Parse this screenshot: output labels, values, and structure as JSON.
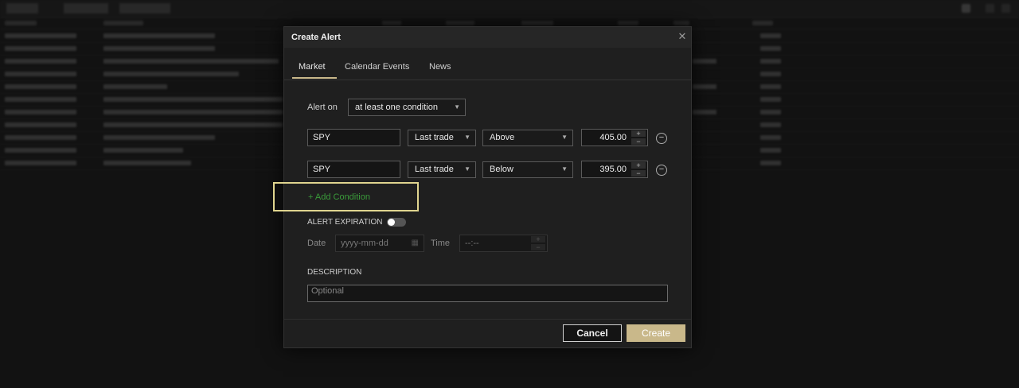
{
  "modal": {
    "title": "Create Alert",
    "close_icon": "close-icon",
    "tabs": [
      {
        "label": "Market",
        "active": true
      },
      {
        "label": "Calendar Events",
        "active": false
      },
      {
        "label": "News",
        "active": false
      }
    ],
    "alert_on": {
      "label": "Alert on",
      "value": "at least one condition"
    },
    "conditions": [
      {
        "symbol": "SPY",
        "field": "Last trade",
        "operator": "Above",
        "value": "405.00"
      },
      {
        "symbol": "SPY",
        "field": "Last trade",
        "operator": "Below",
        "value": "395.00"
      }
    ],
    "add_condition_label": "+ Add Condition",
    "expiration": {
      "label": "ALERT EXPIRATION",
      "enabled": false,
      "date_label": "Date",
      "date_placeholder": "yyyy-mm-dd",
      "time_label": "Time",
      "time_placeholder": "--:--"
    },
    "description": {
      "label": "DESCRIPTION",
      "placeholder": "Optional"
    },
    "buttons": {
      "cancel": "Cancel",
      "create": "Create"
    },
    "colors": {
      "accent": "#c9b88a",
      "add_condition": "#3a9a3a",
      "highlight": "#e0d58f"
    }
  }
}
